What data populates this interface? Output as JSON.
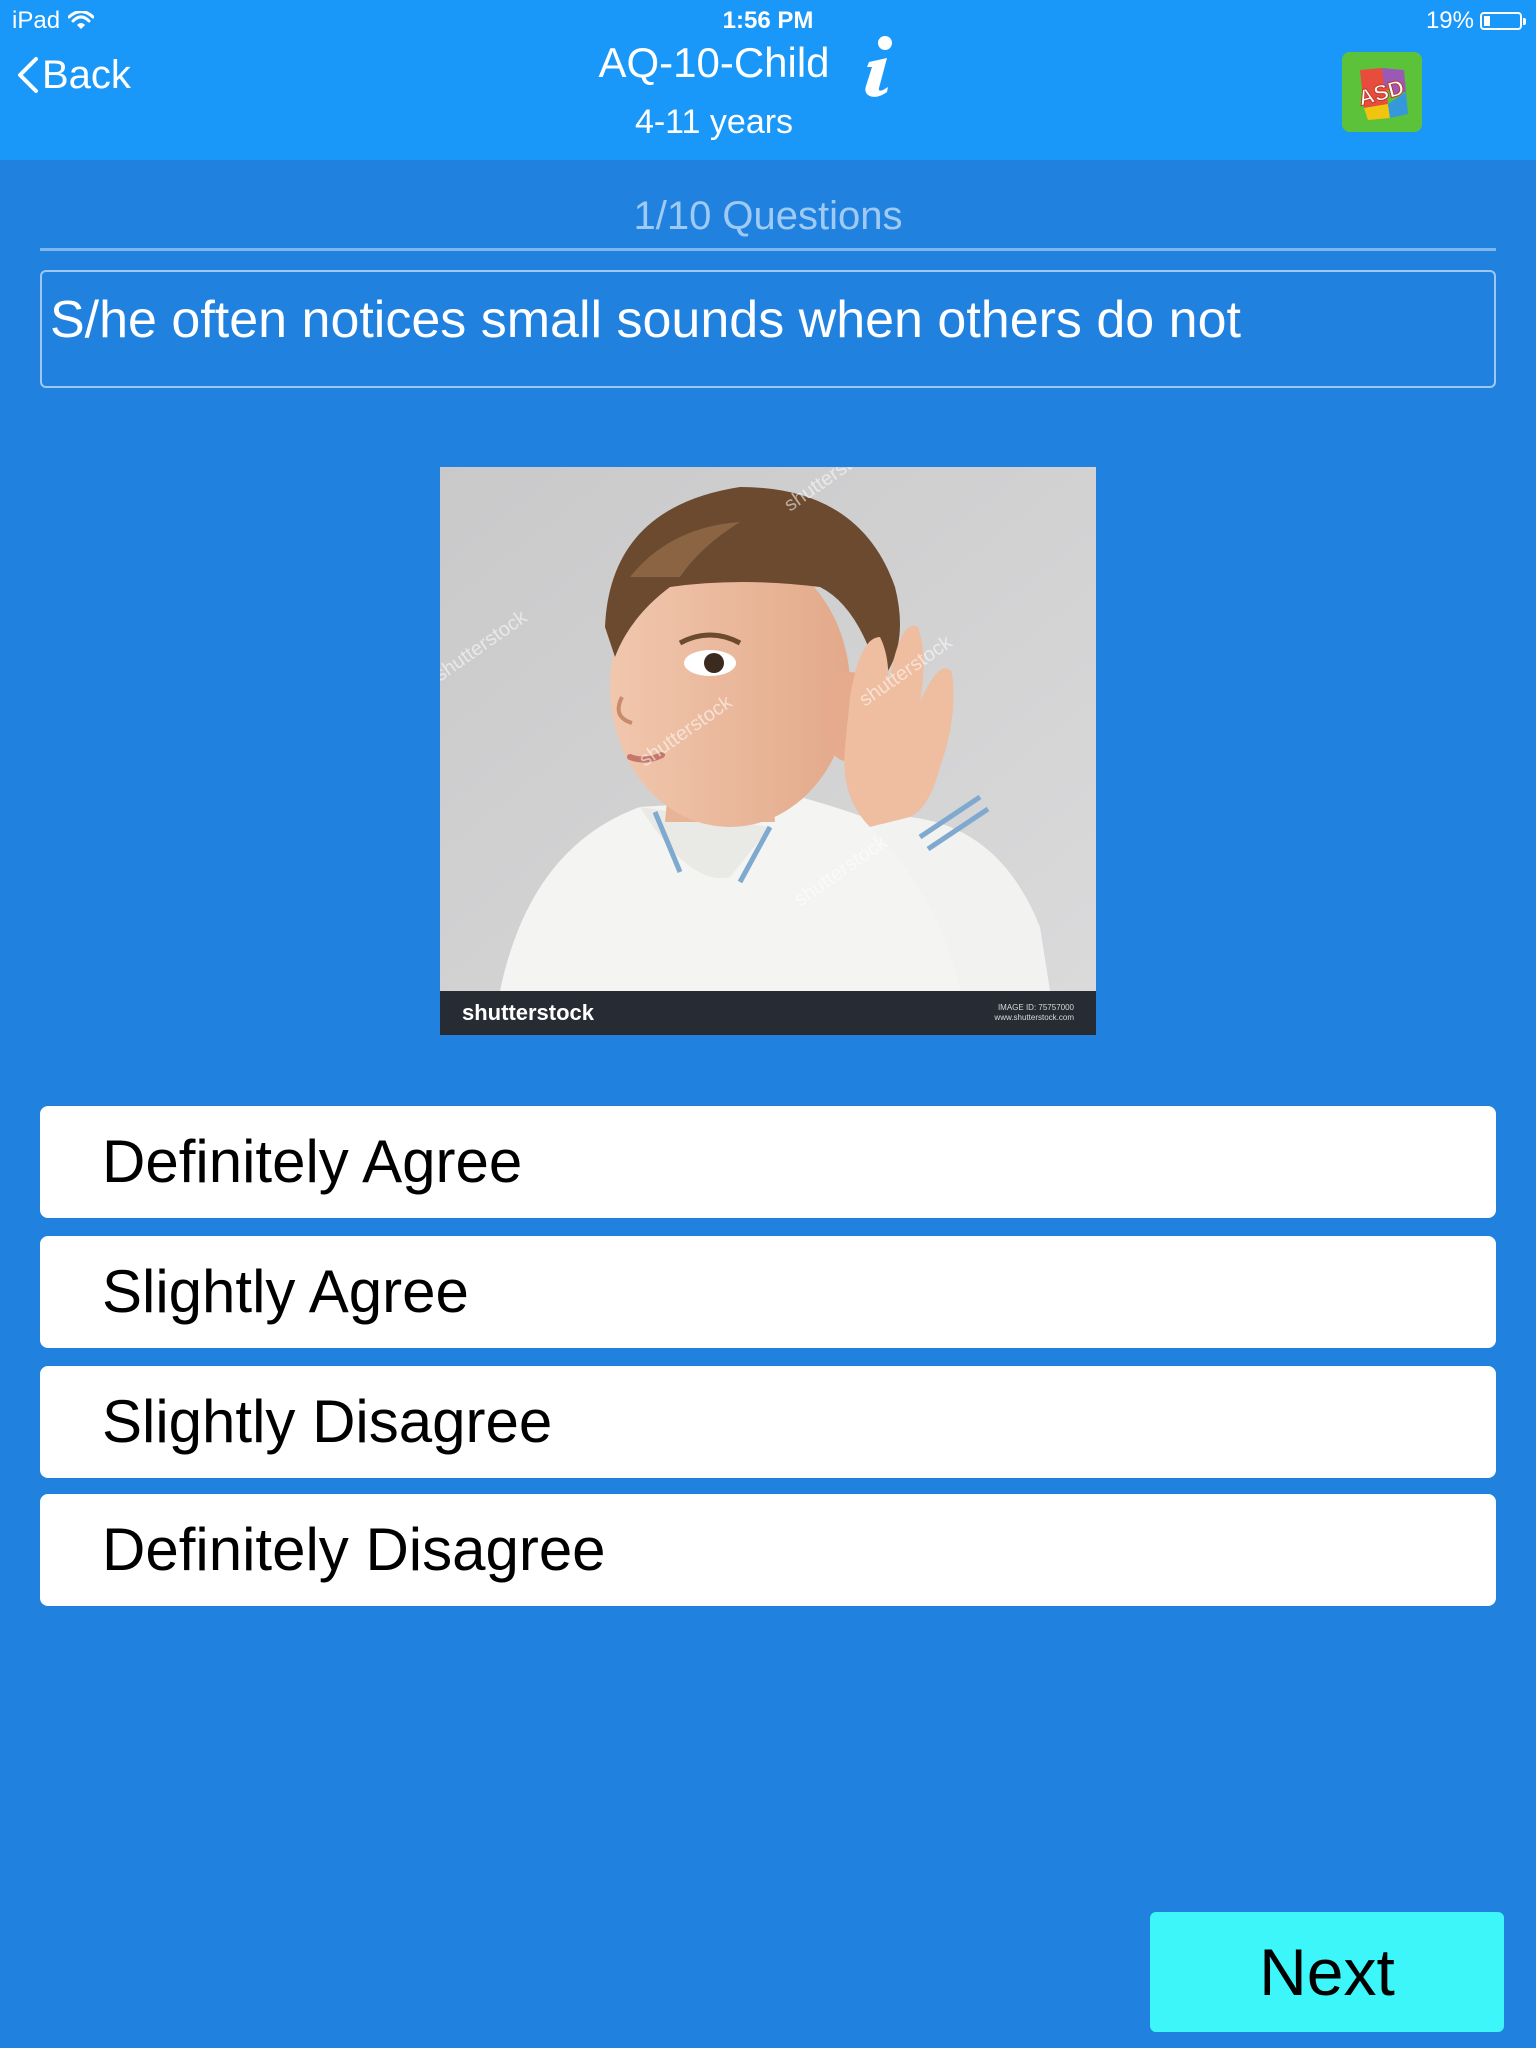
{
  "status_bar": {
    "device": "iPad",
    "time": "1:56 PM",
    "battery_percent": "19%",
    "battery_level": 0.19,
    "wifi_icon": "wifi-icon",
    "battery_icon": "battery-icon"
  },
  "nav": {
    "back_label": "Back",
    "back_icon": "chevron-left-icon",
    "title": "AQ-10-Child",
    "subtitle": "4-11 years",
    "info_icon": "info-icon",
    "logo_icon": "asd-puzzle-logo",
    "logo_text": "ASD"
  },
  "quiz": {
    "progress_label": "1/10 Questions",
    "question": "S/he often notices small sounds when others do not",
    "image": {
      "brand": "shutterstock",
      "image_id_label": "IMAGE ID: 75757000",
      "site": "www.shutterstock.com",
      "watermark": "shutterstock"
    },
    "answers": [
      {
        "label": "Definitely Agree"
      },
      {
        "label": "Slightly Agree"
      },
      {
        "label": "Slightly Disagree"
      },
      {
        "label": "Definitely Disagree"
      }
    ],
    "next_label": "Next"
  },
  "colors": {
    "header": "#1a98f9",
    "background": "#2181df",
    "answer_background": "#ffffff",
    "next_button": "#3cf6fa",
    "progress_text": "#9fcaf4"
  }
}
